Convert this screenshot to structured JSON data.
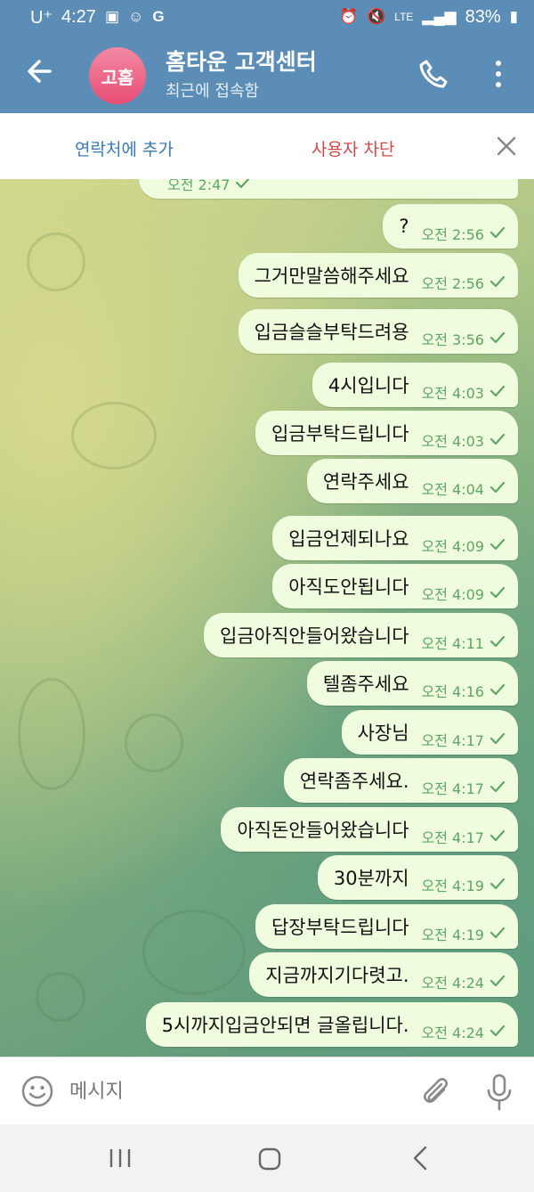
{
  "status_bar": {
    "carrier": "U⁺",
    "time": "4:27",
    "left_icons": [
      "gallery-icon",
      "baby-monitor-icon",
      "google-icon"
    ],
    "right_icons": [
      "alarm-icon",
      "mute-icon",
      "lte-signal-icon"
    ],
    "lte": "LTE",
    "battery": "83%"
  },
  "header": {
    "avatar_text": "고홈",
    "title": "홈타운 고객센터",
    "subtitle": "최근에 접속함",
    "accent_color": "#5b8db6"
  },
  "actions": {
    "add_contact": "연락처에 추가",
    "block_user": "사용자 차단"
  },
  "messages": [
    {
      "text": "",
      "time": "오전 2:47"
    },
    {
      "text": "?",
      "time": "오전 2:56"
    },
    {
      "text": "그거만말씀해주세요",
      "time": "오전 2:56"
    },
    {
      "text": "입금슬슬부탁드려용",
      "time": "오전 3:56"
    },
    {
      "text": "4시입니다",
      "time": "오전 4:03"
    },
    {
      "text": "입금부탁드립니다",
      "time": "오전 4:03"
    },
    {
      "text": "연락주세요",
      "time": "오전 4:04"
    },
    {
      "text": "입금언제되나요",
      "time": "오전 4:09"
    },
    {
      "text": "아직도안됩니다",
      "time": "오전 4:09"
    },
    {
      "text": "입금아직안들어왔습니다",
      "time": "오전 4:11"
    },
    {
      "text": "텔좀주세요",
      "time": "오전 4:16"
    },
    {
      "text": "사장님",
      "time": "오전 4:17"
    },
    {
      "text": "연락좀주세요.",
      "time": "오전 4:17"
    },
    {
      "text": "아직돈안들어왔습니다",
      "time": "오전 4:17"
    },
    {
      "text": "30분까지",
      "time": "오전 4:19"
    },
    {
      "text": "답장부탁드립니다",
      "time": "오전 4:19"
    },
    {
      "text": "지금까지기다렷고.",
      "time": "오전 4:24"
    },
    {
      "text": "5시까지입금안되면 글올립니다.",
      "time": "오전 4:24"
    }
  ],
  "input": {
    "placeholder": "메시지"
  },
  "colors": {
    "bubble": "#effdde",
    "time": "#5fa563",
    "block": "#cc4a4a",
    "add": "#3a7ab4"
  }
}
